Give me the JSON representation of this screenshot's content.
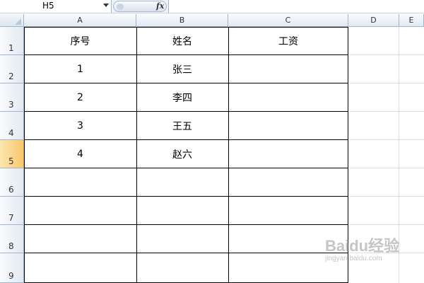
{
  "formula_bar": {
    "name_box": "H5",
    "fx_label": "fx",
    "formula": ""
  },
  "column_headers": [
    "A",
    "B",
    "C",
    "D",
    "E"
  ],
  "row_headers": [
    "1",
    "2",
    "3",
    "4",
    "5",
    "6",
    "7",
    "8",
    "9"
  ],
  "selected_row": "5",
  "table": {
    "header": [
      "序号",
      "姓名",
      "工资"
    ],
    "rows": [
      [
        "1",
        "张三",
        ""
      ],
      [
        "2",
        "李四",
        ""
      ],
      [
        "3",
        "王五",
        ""
      ],
      [
        "4",
        "赵六",
        ""
      ],
      [
        "",
        "",
        ""
      ],
      [
        "",
        "",
        ""
      ],
      [
        "",
        "",
        ""
      ],
      [
        "",
        "",
        ""
      ]
    ]
  },
  "watermark": {
    "main": "Baidu经验",
    "sub": "jingyan.baidu.com"
  }
}
